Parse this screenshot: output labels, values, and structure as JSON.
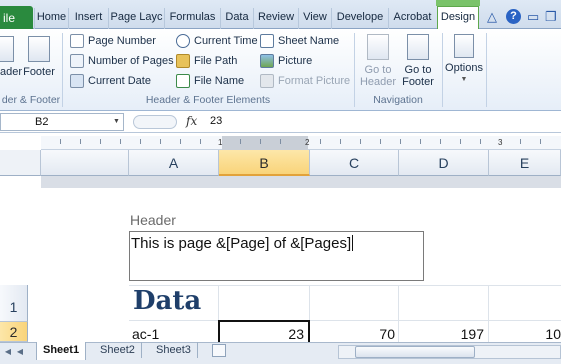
{
  "ribbon_tabs": {
    "file": "ile",
    "home": "Home",
    "insert": "Insert",
    "page_layout": "Page Layc",
    "formulas": "Formulas",
    "data": "Data",
    "review": "Review",
    "view": "View",
    "developer": "Develope",
    "acrobat": "Acrobat",
    "design": "Design"
  },
  "window_controls": {
    "help": "?",
    "minimize": "▭",
    "restore": "❐",
    "close": "✕",
    "up": "△"
  },
  "ribbon": {
    "header_label": "ader",
    "footer_label": "Footer",
    "group_header_footer": "der & Footer",
    "elements": {
      "page_number": "Page Number",
      "number_of_pages": "Number of Pages",
      "current_date": "Current Date",
      "current_time": "Current Time",
      "file_path": "File Path",
      "file_name": "File Name",
      "sheet_name": "Sheet Name",
      "picture": "Picture",
      "format_picture": "Format Picture"
    },
    "group_elements": "Header & Footer Elements",
    "go_to_header": [
      "Go to",
      "Header"
    ],
    "go_to_footer": [
      "Go to",
      "Footer"
    ],
    "group_navigation": "Navigation",
    "options": "Options"
  },
  "formula_bar": {
    "name_box": "B2",
    "fx": "fx",
    "value": "23"
  },
  "ruler": {
    "numbers": [
      "1",
      "2",
      "3"
    ]
  },
  "columns": [
    "A",
    "B",
    "C",
    "D",
    "E"
  ],
  "rows": [
    "1",
    "2"
  ],
  "page": {
    "header_label": "Header",
    "header_text": "This is page &[Page] of &[Pages]",
    "title": "Data",
    "row2": {
      "a": "ac-1",
      "b": "23",
      "c": "70",
      "d": "197",
      "e": "10"
    }
  },
  "sheets": [
    "Sheet1",
    "Sheet2",
    "Sheet3"
  ],
  "colors": {
    "file_tab": "#2a8a3e",
    "selected_header": "#f9d47a",
    "title_text": "#1f3f6a"
  }
}
